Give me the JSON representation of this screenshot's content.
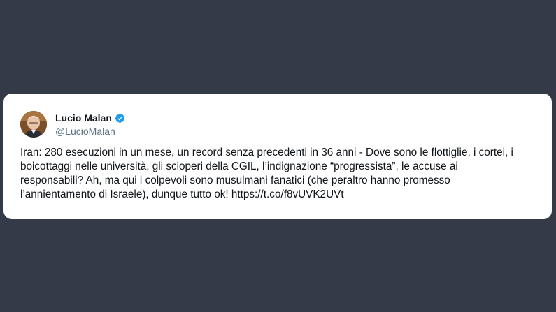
{
  "author": {
    "display_name": "Lucio Malan",
    "handle": "@LucioMalan",
    "verified": true,
    "verified_icon": "verified-badge-icon",
    "verified_color": "#1d9bf0"
  },
  "tweet": {
    "lines": [
      "Iran: 280 esecuzioni in un mese, un record senza precedenti in 36 anni - Dove sono le flottiglie, i cortei, i",
      "boicottaggi nelle università, gli scioperi della CGIL, l’indignazione “progressista”, le accuse ai",
      "responsabili? Ah, ma qui i colpevoli sono musulmani fanatici (che peraltro hanno promesso",
      "l’annientamento di Israele), dunque tutto ok! https://t.co/f8vUVK2UVt"
    ]
  },
  "colors": {
    "background": "#343a47",
    "card": "#ffffff",
    "text": "#0f1419",
    "secondary_text": "#5b7083"
  }
}
